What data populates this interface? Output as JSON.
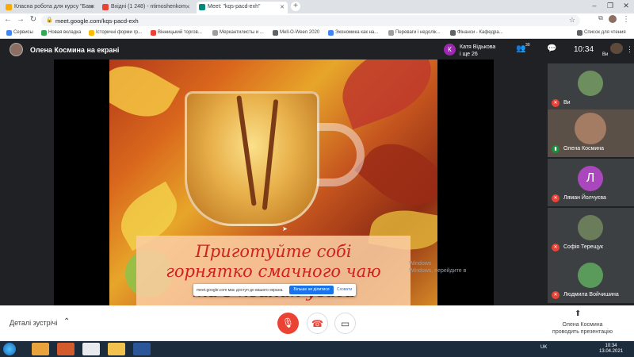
{
  "tabs": [
    {
      "title": "Класна робота для курсу \"Банк",
      "favicon_color": "#f9ab00",
      "active": false
    },
    {
      "title": "Вхідні (1 248) - ntimoshenkom",
      "favicon_color": "#ea4335",
      "active": false
    },
    {
      "title": "Meet: \"kqs-pacd-exh\"",
      "favicon_color": "#00897b",
      "active": true
    }
  ],
  "new_tab_label": "+",
  "window_controls": [
    "–",
    "❐",
    "✕"
  ],
  "nav": {
    "back": "←",
    "forward": "→",
    "reload": "↻"
  },
  "address_bar": {
    "url": "meet.google.com/kqs-pacd-exh"
  },
  "bookmarks": [
    {
      "label": "Сервисы",
      "color": "#4285f4"
    },
    {
      "label": "Новая вкладка",
      "color": "#34a853"
    },
    {
      "label": "Історичні форми гр...",
      "color": "#fbbc04"
    },
    {
      "label": "Вінницький торгов...",
      "color": "#ea4335"
    },
    {
      "label": "Меркантилисты и ...",
      "color": "#9e9e9e"
    },
    {
      "label": "Mell-O-Ween 2020",
      "color": "#5f6368"
    },
    {
      "label": "Экономика как на...",
      "color": "#4285f4"
    },
    {
      "label": "Переваги і недолік...",
      "color": "#9e9e9e"
    },
    {
      "label": "Фінанси - Кафедра...",
      "color": "#5f6368"
    }
  ],
  "reading_list": "Список для чтения",
  "meet": {
    "presenter_title": "Олена Космина на екрані",
    "speaker_initial": "К",
    "speaker_name": "Катя Відькова",
    "speaker_more": "і ще 26",
    "people_count": "30",
    "clock": "10:34",
    "self_label": "Ви"
  },
  "slide": {
    "caption_line1": "Приготуйте собі",
    "caption_line2": "горнятко смачного чаю",
    "caption_line3": "та 5 хвилин уваги"
  },
  "windows_watermark": {
    "line1": "Windows",
    "line2": "Windows, перейдите в"
  },
  "share_banner": {
    "text": "meet.google.com має доступ до вашого екрана.",
    "stop_label": "Більше не ділитися",
    "hide_label": "Сховати"
  },
  "participants": [
    {
      "name": "Ви",
      "avatar_color": "#6d8f5f",
      "initial": ""
    },
    {
      "name": "Олена Космина",
      "avatar_color": "#a37c63",
      "initial": ""
    },
    {
      "name": "Ляман Йолчуєва",
      "avatar_color": "#ab47bc",
      "initial": "Л"
    },
    {
      "name": "Софія Терещук",
      "avatar_color": "#6b7c5a",
      "initial": ""
    },
    {
      "name": "Людмила Войчишина",
      "avatar_color": "#5a9a5a",
      "initial": ""
    }
  ],
  "bottom": {
    "details_label": "Деталі зустрічі",
    "presenting_line1": "Олена Космина",
    "presenting_line2": "проводить презентацію"
  },
  "taskbar": {
    "lang": "UK",
    "time": "10:34",
    "date": "13.04.2021"
  }
}
